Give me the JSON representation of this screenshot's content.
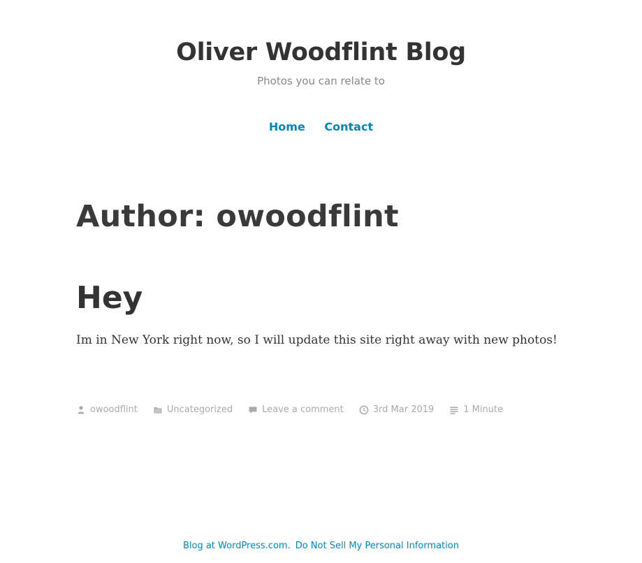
{
  "site": {
    "title": "Oliver Woodflint Blog",
    "description": "Photos you can relate to"
  },
  "nav": {
    "items": [
      {
        "label": "Home"
      },
      {
        "label": "Contact"
      }
    ]
  },
  "archive": {
    "title": "Author: owoodflint"
  },
  "post": {
    "title": "Hey",
    "content": "Im in New York right now, so I will update this site right away with new photos!",
    "meta": {
      "author": "owoodflint",
      "category": "Uncategorized",
      "comments": "Leave a comment",
      "date": "3rd Mar 2019",
      "reading_time": "1 Minute"
    }
  },
  "footer": {
    "credit": "Blog at WordPress.com.",
    "privacy": "Do Not Sell My Personal Information"
  },
  "colors": {
    "link": "#0087be",
    "text": "#333333",
    "muted": "#aaaaaa"
  },
  "icons": [
    "person-icon",
    "folder-icon",
    "comment-icon",
    "clock-icon",
    "reading-time-icon"
  ]
}
